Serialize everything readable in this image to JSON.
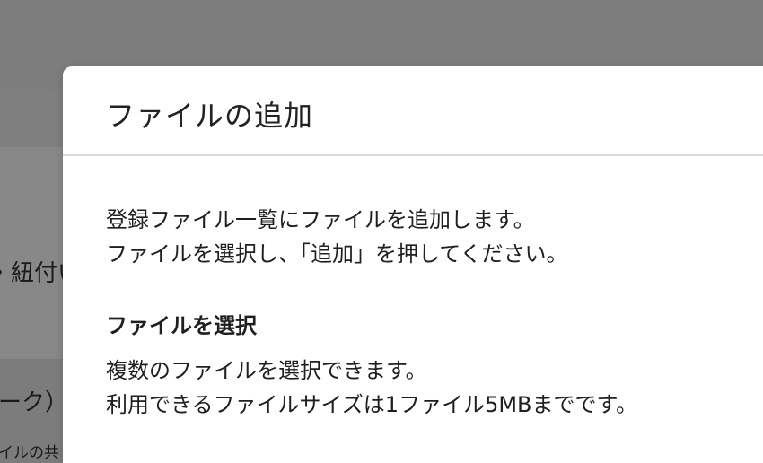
{
  "background": {
    "partial_texts": [
      "・紐付い",
      "ーク）",
      "イルの共"
    ]
  },
  "dialog": {
    "title": "ファイルの追加",
    "intro": [
      "登録ファイル一覧にファイルを追加します。",
      "ファイルを選択し、「追加」を押してください。"
    ],
    "section": {
      "heading": "ファイルを選択",
      "lines": [
        "複数のファイルを選択できます。",
        "利用できるファイルサイズは1ファイル5MBまでです。"
      ]
    }
  }
}
